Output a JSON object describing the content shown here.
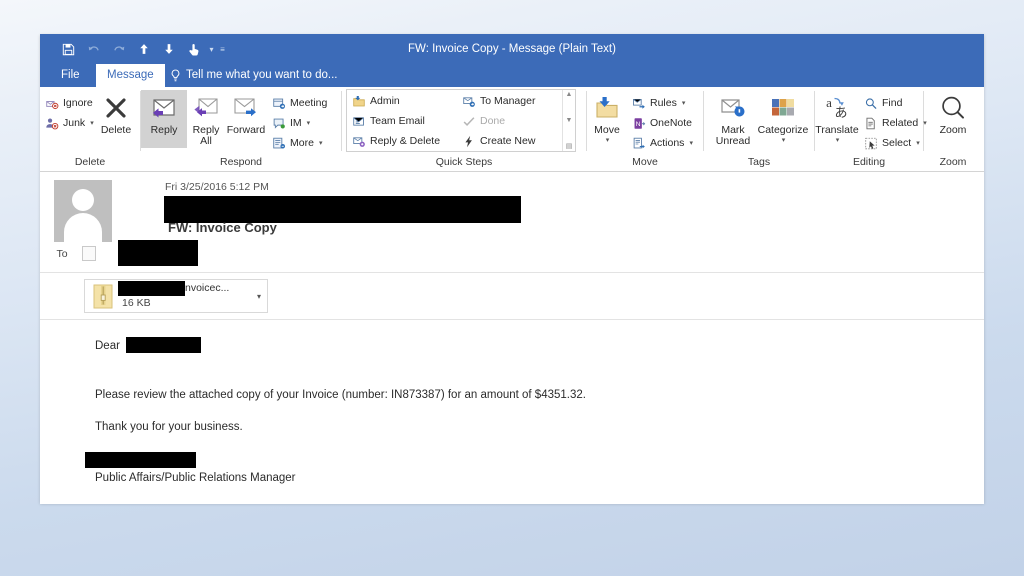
{
  "window": {
    "title": "FW: Invoice Copy - Message (Plain Text)",
    "accent_color": "#3c6bb8",
    "selected_tab_text_color": "#3c6bb8"
  },
  "quick_access": {
    "items": [
      {
        "name": "save-icon",
        "label": "Save",
        "state": "enabled"
      },
      {
        "name": "undo-icon",
        "label": "Undo",
        "state": "disabled"
      },
      {
        "name": "redo-icon",
        "label": "Redo",
        "state": "disabled"
      },
      {
        "name": "previous-item-icon",
        "label": "Previous Item",
        "state": "enabled"
      },
      {
        "name": "next-item-icon",
        "label": "Next Item",
        "state": "enabled"
      },
      {
        "name": "touch-mode-icon",
        "label": "Touch/Mouse Mode",
        "state": "enabled"
      }
    ],
    "overflow_label": "Customize Quick Access Toolbar"
  },
  "tabs": {
    "file": "File",
    "message": "Message",
    "tell_me": "Tell me what you want to do..."
  },
  "ribbon": {
    "groups": [
      {
        "label": "Delete",
        "small_buttons": [
          {
            "label": "Ignore",
            "icon": "ignore-icon",
            "dropdown": false,
            "disabled": false
          },
          {
            "label": "Junk",
            "icon": "junk-icon",
            "dropdown": true,
            "disabled": false
          }
        ],
        "big_buttons": [
          {
            "label": "Delete",
            "icon": "delete-x-icon",
            "selected": false
          }
        ]
      },
      {
        "label": "Respond",
        "big_buttons": [
          {
            "label": "Reply",
            "icon": "reply-icon",
            "selected": true
          },
          {
            "label": "Reply All",
            "icon": "reply-all-icon",
            "selected": false
          },
          {
            "label": "Forward",
            "icon": "forward-icon",
            "selected": false
          }
        ],
        "small_buttons": [
          {
            "label": "Meeting",
            "icon": "meeting-icon",
            "dropdown": false,
            "disabled": false
          },
          {
            "label": "IM",
            "icon": "im-icon",
            "dropdown": true,
            "disabled": false
          },
          {
            "label": "More",
            "icon": "more-icon",
            "dropdown": true,
            "disabled": false
          }
        ]
      },
      {
        "label": "Quick Steps",
        "has_dialog_launcher": true,
        "quick_steps_col1": [
          {
            "label": "Admin",
            "icon": "folder-move-icon",
            "disabled": false
          },
          {
            "label": "Team Email",
            "icon": "team-email-icon",
            "disabled": false
          },
          {
            "label": "Reply & Delete",
            "icon": "reply-delete-icon",
            "disabled": false
          }
        ],
        "quick_steps_col2": [
          {
            "label": "To Manager",
            "icon": "to-manager-icon",
            "disabled": false
          },
          {
            "label": "Done",
            "icon": "done-check-icon",
            "disabled": true
          },
          {
            "label": "Create New",
            "icon": "create-new-icon",
            "disabled": false
          }
        ]
      },
      {
        "label": "Move",
        "big_buttons": [
          {
            "label": "Move",
            "icon": "move-folder-icon",
            "dropdown": true,
            "selected": false
          }
        ],
        "small_buttons": [
          {
            "label": "Rules",
            "icon": "rules-icon",
            "dropdown": true,
            "disabled": false
          },
          {
            "label": "OneNote",
            "icon": "onenote-icon",
            "dropdown": false,
            "disabled": false
          },
          {
            "label": "Actions",
            "icon": "actions-icon",
            "dropdown": true,
            "disabled": false
          }
        ]
      },
      {
        "label": "Tags",
        "has_dialog_launcher": true,
        "big_buttons": [
          {
            "label": "Mark Unread",
            "icon": "mark-unread-icon",
            "selected": false
          },
          {
            "label": "Categorize",
            "icon": "categorize-icon",
            "dropdown": true,
            "selected": false
          }
        ]
      },
      {
        "label": "Editing",
        "big_buttons": [
          {
            "label": "Translate",
            "icon": "translate-icon",
            "dropdown": true,
            "selected": false
          }
        ],
        "small_buttons": [
          {
            "label": "Find",
            "icon": "find-icon",
            "dropdown": false,
            "disabled": false
          },
          {
            "label": "Related",
            "icon": "related-icon",
            "dropdown": true,
            "disabled": false
          },
          {
            "label": "Select",
            "icon": "select-icon",
            "dropdown": true,
            "disabled": false
          }
        ]
      },
      {
        "label": "Zoom",
        "big_buttons": [
          {
            "label": "Zoom",
            "icon": "zoom-magnifier-icon",
            "selected": false
          }
        ]
      }
    ]
  },
  "message": {
    "datetime": "Fri 3/25/2016 5:12 PM",
    "sender": "",
    "sender_redacted": true,
    "subject": "FW: Invoice Copy",
    "to_label": "To",
    "to_value": "",
    "to_redacted": true,
    "attachment": {
      "name_visible": "nvoicec...",
      "size": "16 KB",
      "icon": "zip-file-icon",
      "dropdown_label": "Attachment options"
    },
    "body": {
      "greeting": "Dear",
      "greeting_redacted": true,
      "paragraph": "Please review the attached copy of your Invoice (number: IN873387) for an amount of $4351.32.",
      "closing": "Thank you for your business.",
      "signature_name_redacted": true,
      "signature_title": "Public Affairs/Public Relations Manager"
    }
  }
}
